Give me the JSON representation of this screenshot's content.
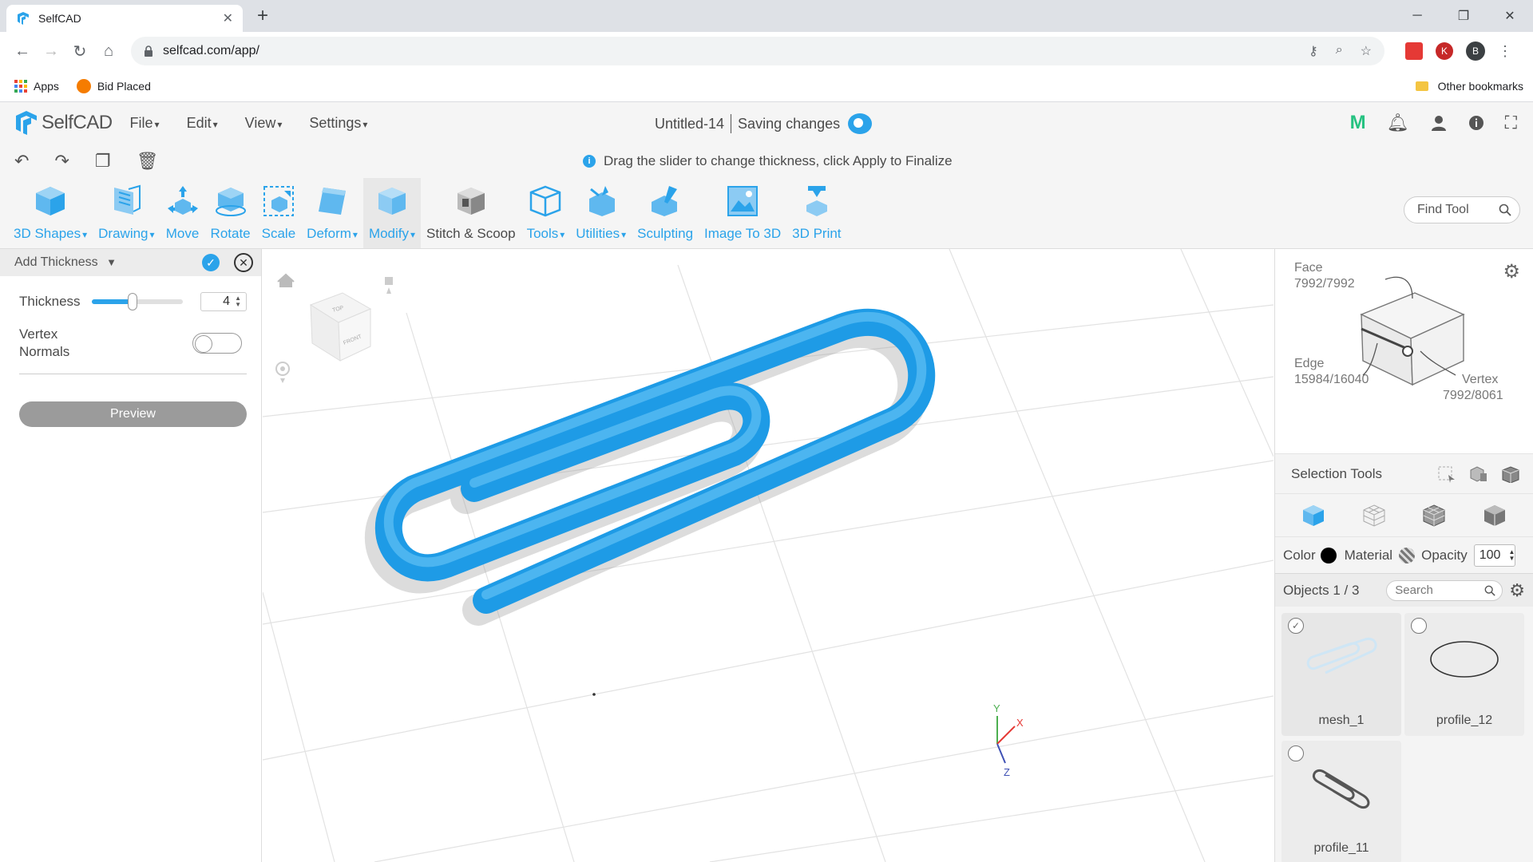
{
  "browser": {
    "tab_title": "SelfCAD",
    "url": "selfcad.com/app/",
    "bookmarks": [
      "Apps",
      "Bid Placed"
    ],
    "other_bookmarks": "Other bookmarks",
    "profile_initial": "B",
    "ext_k": "K"
  },
  "app": {
    "logo_text": "SelfCAD",
    "menus": [
      "File",
      "Edit",
      "View",
      "Settings"
    ],
    "doc_title": "Untitled-14",
    "save_status": "Saving changes",
    "user_initial": "M",
    "hint": "Drag the slider to change thickness, click Apply to Finalize",
    "hint_icon": "i"
  },
  "toolbar": {
    "tools": [
      {
        "label": "3D Shapes",
        "dropdown": true
      },
      {
        "label": "Drawing",
        "dropdown": true
      },
      {
        "label": "Move",
        "dropdown": false
      },
      {
        "label": "Rotate",
        "dropdown": false
      },
      {
        "label": "Scale",
        "dropdown": false
      },
      {
        "label": "Deform",
        "dropdown": true
      },
      {
        "label": "Modify",
        "dropdown": true
      },
      {
        "label": "Stitch & Scoop",
        "dropdown": false
      },
      {
        "label": "Tools",
        "dropdown": true
      },
      {
        "label": "Utilities",
        "dropdown": true
      },
      {
        "label": "Sculpting",
        "dropdown": false
      },
      {
        "label": "Image To 3D",
        "dropdown": false
      },
      {
        "label": "3D Print",
        "dropdown": false
      }
    ],
    "find_tool_placeholder": "Find Tool"
  },
  "left_panel": {
    "title": "Add Thickness",
    "thickness_label": "Thickness",
    "thickness_value": "4",
    "thickness_slider_fraction": 0.45,
    "vertex_normals_label_1": "Vertex",
    "vertex_normals_label_2": "Normals",
    "vertex_normals_on": false,
    "preview_label": "Preview"
  },
  "viewcube": {
    "top": "TOP",
    "front": "FRONT"
  },
  "axes": {
    "x": "X",
    "y": "Y",
    "z": "Z"
  },
  "right_panel": {
    "face_label": "Face",
    "face_count": "7992/7992",
    "edge_label": "Edge",
    "edge_count": "15984/16040",
    "vertex_label": "Vertex",
    "vertex_count": "7992/8061",
    "selection_tools_label": "Selection Tools",
    "color_label": "Color",
    "color_value": "#000000",
    "material_label": "Material",
    "opacity_label": "Opacity",
    "opacity_value": "100",
    "objects_label": "Objects 1 / 3",
    "search_placeholder": "Search",
    "objects": [
      {
        "name": "mesh_1",
        "selected": true
      },
      {
        "name": "profile_12",
        "selected": false
      },
      {
        "name": "profile_11",
        "selected": false
      }
    ]
  },
  "colors": {
    "accent": "#2ba3ea",
    "clip_blue": "#1e9be6"
  }
}
